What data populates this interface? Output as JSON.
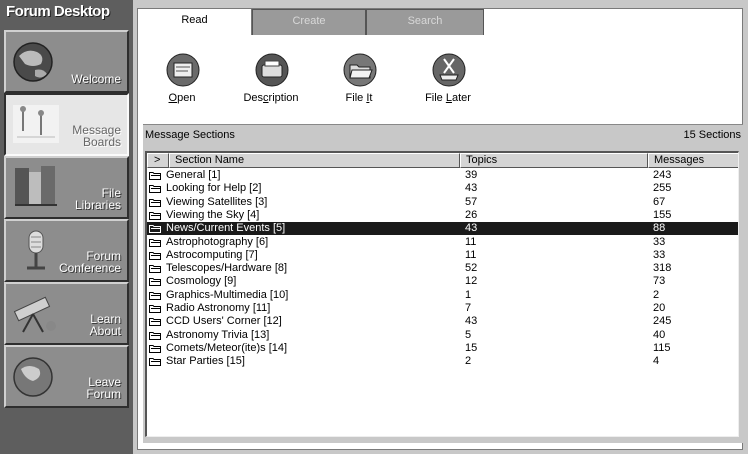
{
  "app": {
    "title": "Forum Desktop"
  },
  "sidebar": {
    "items": [
      {
        "label": "Welcome",
        "icon": "globe-icon",
        "active": false
      },
      {
        "label": "Message\nBoards",
        "icon": "pushpins-icon",
        "active": true
      },
      {
        "label": "File\nLibraries",
        "icon": "books-icon",
        "active": false
      },
      {
        "label": "Forum\nConference",
        "icon": "microphone-icon",
        "active": false
      },
      {
        "label": "Learn\nAbout",
        "icon": "telescope-icon",
        "active": false
      },
      {
        "label": "Leave\nForum",
        "icon": "globe-exit-icon",
        "active": false
      }
    ]
  },
  "tabs": [
    {
      "label": "Read",
      "active": true
    },
    {
      "label": "Create",
      "active": false
    },
    {
      "label": "Search",
      "active": false
    }
  ],
  "toolbar": {
    "open_label": "pen",
    "open_mnemonic": "O",
    "description_label_pre": "Des",
    "description_mnemonic": "c",
    "description_label_post": "ription",
    "file_it_label": "File ",
    "file_it_mnemonic": "I",
    "file_it_label_post": "t",
    "file_later_label": "File ",
    "file_later_mnemonic": "L",
    "file_later_label_post": "ater"
  },
  "sections": {
    "title": "Message Sections",
    "count_label": "15 Sections",
    "columns": {
      "expand": ">",
      "name": "Section Name",
      "topics": "Topics",
      "messages": "Messages"
    },
    "rows": [
      {
        "name": "General [1]",
        "topics": "39",
        "messages": "243",
        "selected": false
      },
      {
        "name": "Looking for Help [2]",
        "topics": "43",
        "messages": "255",
        "selected": false
      },
      {
        "name": "Viewing Satellites [3]",
        "topics": "57",
        "messages": "67",
        "selected": false
      },
      {
        "name": "Viewing the Sky [4]",
        "topics": "26",
        "messages": "155",
        "selected": false
      },
      {
        "name": "News/Current Events [5]",
        "topics": "43",
        "messages": "88",
        "selected": true
      },
      {
        "name": "Astrophotography [6]",
        "topics": "11",
        "messages": "33",
        "selected": false
      },
      {
        "name": "Astrocomputing [7]",
        "topics": "11",
        "messages": "33",
        "selected": false
      },
      {
        "name": "Telescopes/Hardware [8]",
        "topics": "52",
        "messages": "318",
        "selected": false
      },
      {
        "name": "Cosmology [9]",
        "topics": "12",
        "messages": "73",
        "selected": false
      },
      {
        "name": "Graphics-Multimedia [10]",
        "topics": "1",
        "messages": "2",
        "selected": false
      },
      {
        "name": "Radio Astronomy [11]",
        "topics": "7",
        "messages": "20",
        "selected": false
      },
      {
        "name": "CCD Users' Corner [12]",
        "topics": "43",
        "messages": "245",
        "selected": false
      },
      {
        "name": "Astronomy Trivia [13]",
        "topics": "5",
        "messages": "40",
        "selected": false
      },
      {
        "name": "Comets/Meteor(ite)s [14]",
        "topics": "15",
        "messages": "115",
        "selected": false
      },
      {
        "name": "Star Parties [15]",
        "topics": "2",
        "messages": "4",
        "selected": false
      }
    ]
  }
}
